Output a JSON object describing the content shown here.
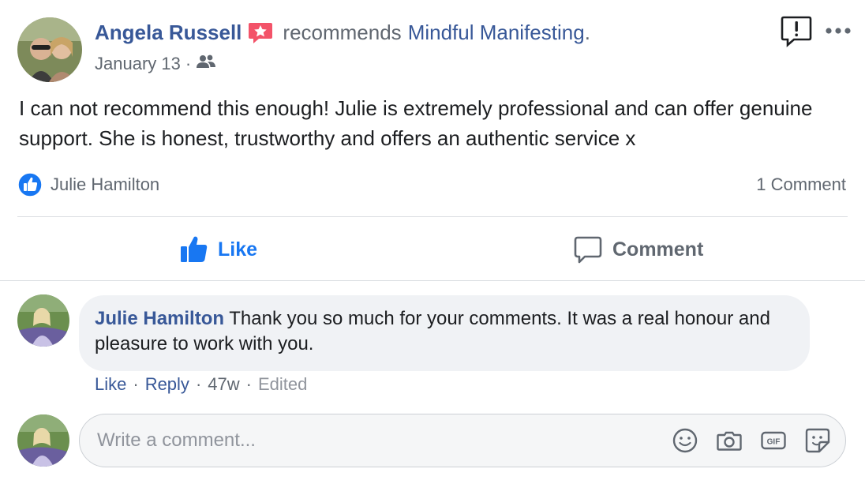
{
  "post": {
    "author": "Angela Russell",
    "recommends_text": "recommends",
    "page_name": "Mindful Manifesting",
    "page_suffix": ".",
    "date": "January 13",
    "meta_separator": "·",
    "audience_icon": "friends-icon",
    "body": "I can not recommend this enough! Julie is extremely professional and can offer genuine support. She is honest, trustworthy and offers an authentic service x",
    "reactor_name": "Julie Hamilton",
    "comment_count": "1 Comment"
  },
  "actions": {
    "like_label": "Like",
    "comment_label": "Comment"
  },
  "comment": {
    "author": "Julie Hamilton",
    "text": "Thank you so much for your comments. It was a real honour and pleasure to work with you.",
    "like_label": "Like",
    "reply_label": "Reply",
    "age": "47w",
    "edited_label": "Edited",
    "separator": "·"
  },
  "composer": {
    "placeholder": "Write a comment...",
    "icons": [
      "emoji-icon",
      "camera-icon",
      "gif-icon",
      "sticker-icon"
    ]
  },
  "colors": {
    "link_blue": "#385898",
    "like_blue": "#1877f2",
    "secondary_text": "#606770",
    "recommend_badge": "#f35369",
    "bubble_bg": "#f0f2f5"
  }
}
